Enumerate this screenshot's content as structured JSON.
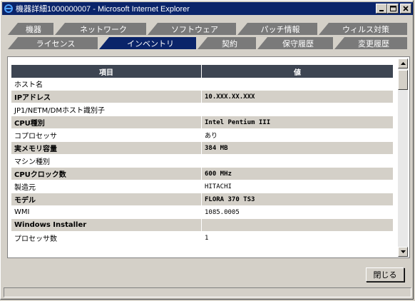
{
  "window": {
    "title": "機器詳細1000000007 - Microsoft Internet Explorer",
    "controls": [
      "minimize",
      "maximize",
      "close"
    ]
  },
  "tabs_row1": [
    {
      "label": "機器",
      "active": false
    },
    {
      "label": "ネットワーク",
      "active": false
    },
    {
      "label": "ソフトウェア",
      "active": false
    },
    {
      "label": "パッチ情報",
      "active": false
    },
    {
      "label": "ウィルス対策",
      "active": false
    }
  ],
  "tabs_row2": [
    {
      "label": "ライセンス",
      "active": false
    },
    {
      "label": "インベントリ",
      "active": true
    },
    {
      "label": "契約",
      "active": false
    },
    {
      "label": "保守履歴",
      "active": false
    },
    {
      "label": "変更履歴",
      "active": false
    }
  ],
  "table": {
    "headers": [
      "項目",
      "値"
    ],
    "rows": [
      {
        "item": "ホスト名",
        "value": ""
      },
      {
        "item": "IPアドレス",
        "value": "10.XXX.XX.XXX"
      },
      {
        "item": "JP1/NETM/DMホスト識別子",
        "value": ""
      },
      {
        "item": "CPU種別",
        "value": "Intel Pentium III"
      },
      {
        "item": "コプロセッサ",
        "value": "あり"
      },
      {
        "item": "実メモリ容量",
        "value": "384 MB"
      },
      {
        "item": "マシン種別",
        "value": ""
      },
      {
        "item": "CPUクロック数",
        "value": "600 MHz"
      },
      {
        "item": "製造元",
        "value": "HITACHI"
      },
      {
        "item": "モデル",
        "value": "FLORA 370 TS3"
      },
      {
        "item": "WMI",
        "value": "1085.0005"
      },
      {
        "item": "Windows Installer",
        "value": ""
      },
      {
        "item": "プロセッサ数",
        "value": "1"
      }
    ]
  },
  "buttons": {
    "close_label": "閉じる"
  },
  "colors": {
    "titlebar": "#0a246a",
    "active_tab": "#0a246a",
    "inactive_tab": "#7a7a7a",
    "table_header": "#3d4552"
  }
}
